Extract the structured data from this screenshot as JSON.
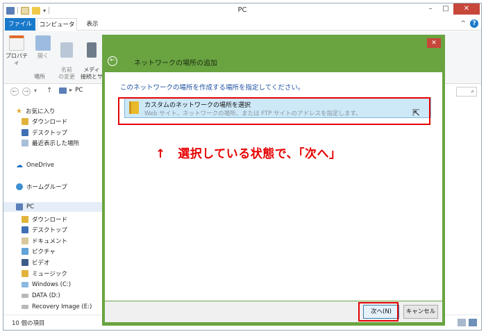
{
  "window": {
    "title": "PC",
    "minimize_glyph": "–",
    "maximize_glyph": "□",
    "close_glyph": "✕"
  },
  "quick_access": {
    "dropdown_glyph": "▾"
  },
  "ribbon": {
    "tabs": [
      {
        "label": "ファイル"
      },
      {
        "label": "コンピューター"
      },
      {
        "label": "表示"
      }
    ],
    "collapse_glyph": "^",
    "help_glyph": "?",
    "buttons": [
      {
        "label": "プロパティ"
      },
      {
        "label": "開く"
      },
      {
        "label": "名前\nの変更"
      },
      {
        "label": "メディ\n接続とサ"
      }
    ],
    "group_label": "場所"
  },
  "address": {
    "back_glyph": "←",
    "forward_glyph": "→",
    "recent_glyph": "▾",
    "up_glyph": "↑",
    "separator": "▸",
    "path": "PC",
    "search_glyph": "⌕"
  },
  "nav": {
    "favorites": {
      "label": "お気に入り",
      "items": [
        {
          "label": "ダウンロード"
        },
        {
          "label": "デスクトップ"
        },
        {
          "label": "最近表示した場所"
        }
      ]
    },
    "onedrive": "OneDrive",
    "homegroup": "ホームグループ",
    "pc": {
      "label": "PC",
      "items": [
        {
          "label": "ダウンロード"
        },
        {
          "label": "デスクトップ"
        },
        {
          "label": "ドキュメント"
        },
        {
          "label": "ピクチャ"
        },
        {
          "label": "ビデオ"
        },
        {
          "label": "ミュージック"
        },
        {
          "label": "Windows (C:)"
        },
        {
          "label": "DATA (D:)"
        },
        {
          "label": "Recovery Image (E:)"
        }
      ]
    }
  },
  "status": {
    "item_count": "10 個の項目"
  },
  "dialog": {
    "close_glyph": "✕",
    "back_glyph": "←",
    "title": "ネットワークの場所の追加",
    "instruction": "このネットワークの場所を作成する場所を指定してください。",
    "option": {
      "title": "カスタムのネットワークの場所を選択",
      "description": "Web サイト、ネットワークの場所、または FTP サイトのアドレスを指定します。"
    },
    "next_label": "次へ(N)",
    "cancel_label": "キャンセル"
  },
  "annotation": {
    "text": "↑　選択している状態で、「次へ」"
  },
  "colors": {
    "accent_blue": "#1979ca",
    "dialog_green": "#6aa441",
    "highlight_red": "#e60000",
    "selected_option": "#cde8f7"
  }
}
